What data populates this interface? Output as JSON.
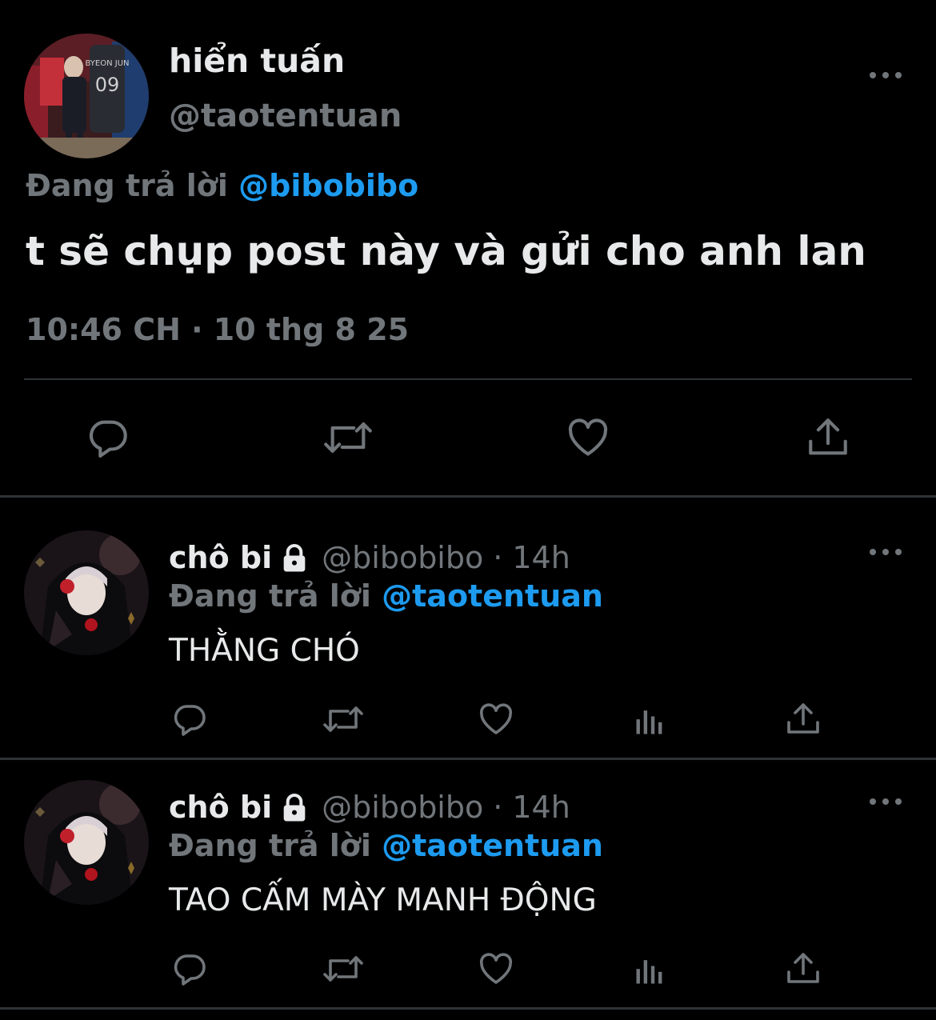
{
  "main_tweet": {
    "display_name": "hiển tuấn",
    "handle": "@taotentuan",
    "replying_prefix": "Đang trả lời",
    "replying_to": "@bibobibo",
    "text": "t sẽ chụp post này và gửi cho anh lan",
    "timestamp": "10:46 CH · 10 thg 8 25",
    "actions": [
      "reply-icon",
      "retweet-icon",
      "heart-icon",
      "share-icon"
    ]
  },
  "replies": [
    {
      "display_name": "chô bi",
      "handle": "@bibobibo",
      "separator": "·",
      "time": "14h",
      "replying_prefix": "Đang trả lời",
      "replying_to": "@taotentuan",
      "text": "THẰNG CHÓ"
    },
    {
      "display_name": "chô bi",
      "handle": "@bibobibo",
      "separator": "·",
      "time": "14h",
      "replying_prefix": "Đang trả lời",
      "replying_to": "@taotentuan",
      "text": "TAO CẤM MÀY MANH ĐỘNG"
    }
  ],
  "colors": {
    "background": "#000000",
    "primary_text": "#e7e9ea",
    "secondary_text": "#71767b",
    "link": "#1d9bf0",
    "divider": "#2f3336"
  }
}
